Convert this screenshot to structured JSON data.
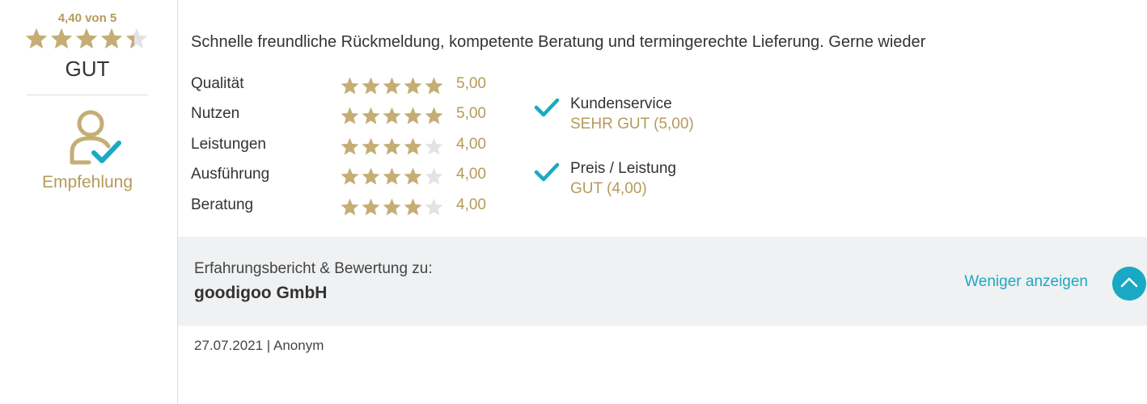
{
  "summary": {
    "score_text": "4,40 von 5",
    "rating": 4.4,
    "grade": "GUT",
    "recommendation_label": "Empfehlung",
    "recommendation_icon": "person-check-icon"
  },
  "review": {
    "text": "Schnelle freundliche Rückmeldung, kompetente Beratung und termingerechte Lieferung. Gerne wieder",
    "criteria": [
      {
        "label": "Qualität",
        "rating": 5,
        "value": "5,00"
      },
      {
        "label": "Nutzen",
        "rating": 5,
        "value": "5,00"
      },
      {
        "label": "Leistungen",
        "rating": 4,
        "value": "4,00"
      },
      {
        "label": "Ausführung",
        "rating": 4,
        "value": "4,00"
      },
      {
        "label": "Beratung",
        "rating": 4,
        "value": "4,00"
      }
    ],
    "features": [
      {
        "label": "Kundenservice",
        "value": "SEHR GUT (5,00)",
        "icon": "check-icon"
      },
      {
        "label": "Preis / Leistung",
        "value": "GUT (4,00)",
        "icon": "check-icon"
      }
    ]
  },
  "company": {
    "caption": "Erfahrungsbericht & Bewertung zu:",
    "name": "goodigoo GmbH",
    "less_link": "Weniger anzeigen",
    "less_button_icon": "chevron-up-icon"
  },
  "meta": {
    "text": "27.07.2021 | Anonym"
  },
  "colors": {
    "gold": "#c5ad74",
    "star_empty": "#e3e3e3",
    "accent": "#1aa9c4",
    "bar_bg": "#f0f1f2"
  }
}
